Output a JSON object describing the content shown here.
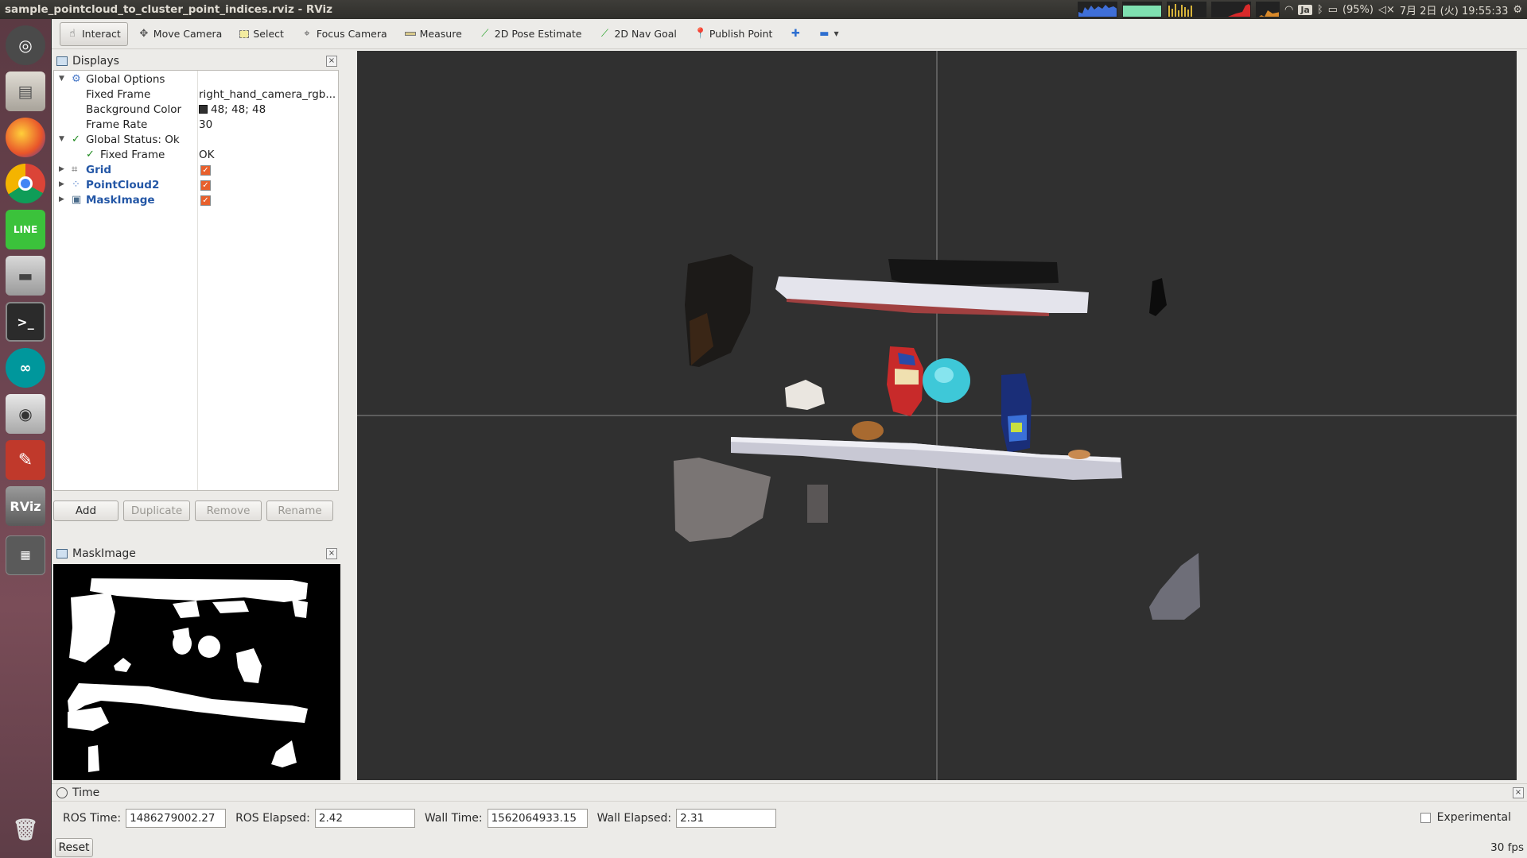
{
  "window": {
    "title": "sample_pointcloud_to_cluster_point_indices.rviz - RViz"
  },
  "tray": {
    "ime": "Ja",
    "battery": "(95%)",
    "datetime": "7月 2日 (火) 19:55:33"
  },
  "launcher": {
    "items": [
      "ubuntu-dash",
      "files",
      "firefox",
      "chrome",
      "line",
      "disk",
      "terminal",
      "arduino",
      "camera",
      "settings",
      "rviz",
      "workspaces",
      "trash"
    ]
  },
  "toolbar": {
    "tools": [
      {
        "label": "Interact",
        "icon": "hand-icon"
      },
      {
        "label": "Move Camera",
        "icon": "move-icon"
      },
      {
        "label": "Select",
        "icon": "select-icon"
      },
      {
        "label": "Focus Camera",
        "icon": "focus-icon"
      },
      {
        "label": "Measure",
        "icon": "ruler-icon"
      },
      {
        "label": "2D Pose Estimate",
        "icon": "arrow-green-icon"
      },
      {
        "label": "2D Nav Goal",
        "icon": "arrow-green-icon"
      },
      {
        "label": "Publish Point",
        "icon": "pin-icon"
      }
    ]
  },
  "displays": {
    "title": "Displays",
    "global_options": "Global Options",
    "fixed_frame_label": "Fixed Frame",
    "fixed_frame_value": "right_hand_camera_rgb...",
    "bg_color_label": "Background Color",
    "bg_color_value": "48; 48; 48",
    "bg_color_hex": "#303030",
    "frame_rate_label": "Frame Rate",
    "frame_rate_value": "30",
    "global_status": "Global Status: Ok",
    "status_fixed_frame": "Fixed Frame",
    "status_fixed_frame_value": "OK",
    "grid": "Grid",
    "pointcloud": "PointCloud2",
    "maskimage": "MaskImage",
    "buttons": {
      "add": "Add",
      "duplicate": "Duplicate",
      "remove": "Remove",
      "rename": "Rename"
    }
  },
  "mask_panel": {
    "title": "MaskImage"
  },
  "time": {
    "title": "Time",
    "ros_time_label": "ROS Time:",
    "ros_time": "1486279002.27",
    "ros_elapsed_label": "ROS Elapsed:",
    "ros_elapsed": "2.42",
    "wall_time_label": "Wall Time:",
    "wall_time": "1562064933.15",
    "wall_elapsed_label": "Wall Elapsed:",
    "wall_elapsed": "2.31",
    "experimental": "Experimental",
    "reset": "Reset",
    "fps": "30 fps"
  }
}
